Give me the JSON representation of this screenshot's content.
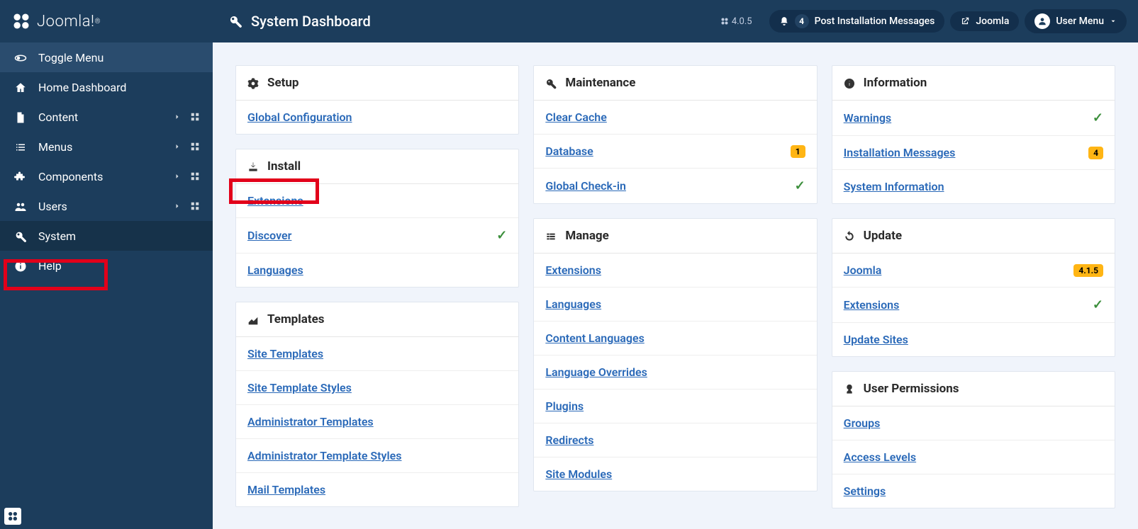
{
  "header": {
    "logo_text": "Joomla!",
    "title": "System Dashboard",
    "version": "4.0.5",
    "notifications": {
      "count": "4",
      "label": "Post Installation Messages"
    },
    "site_link": "Joomla",
    "user_menu": "User Menu"
  },
  "sidebar": {
    "toggle": "Toggle Menu",
    "items": [
      {
        "label": "Home Dashboard",
        "icon": "home"
      },
      {
        "label": "Content",
        "icon": "file",
        "expandable": true,
        "dash": true
      },
      {
        "label": "Menus",
        "icon": "list",
        "expandable": true,
        "dash": true
      },
      {
        "label": "Components",
        "icon": "puzzle",
        "expandable": true,
        "dash": true
      },
      {
        "label": "Users",
        "icon": "users",
        "expandable": true,
        "dash": true
      },
      {
        "label": "System",
        "icon": "wrench",
        "active": true,
        "highlight": true
      },
      {
        "label": "Help",
        "icon": "info"
      }
    ]
  },
  "panels": {
    "setup": {
      "title": "Setup",
      "links": [
        {
          "label": "Global Configuration"
        }
      ]
    },
    "install": {
      "title": "Install",
      "links": [
        {
          "label": "Extensions",
          "highlight": true
        },
        {
          "label": "Discover",
          "check": true
        },
        {
          "label": "Languages"
        }
      ]
    },
    "templates": {
      "title": "Templates",
      "links": [
        {
          "label": "Site Templates"
        },
        {
          "label": "Site Template Styles"
        },
        {
          "label": "Administrator Templates"
        },
        {
          "label": "Administrator Template Styles"
        },
        {
          "label": "Mail Templates"
        }
      ]
    },
    "maintenance": {
      "title": "Maintenance",
      "links": [
        {
          "label": "Clear Cache"
        },
        {
          "label": "Database",
          "badge": "1"
        },
        {
          "label": "Global Check-in",
          "check": true
        }
      ]
    },
    "manage": {
      "title": "Manage",
      "links": [
        {
          "label": "Extensions"
        },
        {
          "label": "Languages"
        },
        {
          "label": "Content Languages"
        },
        {
          "label": "Language Overrides"
        },
        {
          "label": "Plugins"
        },
        {
          "label": "Redirects"
        },
        {
          "label": "Site Modules"
        }
      ]
    },
    "information": {
      "title": "Information",
      "links": [
        {
          "label": "Warnings",
          "check": true
        },
        {
          "label": "Installation Messages",
          "badge": "4"
        },
        {
          "label": "System Information"
        }
      ]
    },
    "update": {
      "title": "Update",
      "links": [
        {
          "label": "Joomla",
          "badge": "4.1.5"
        },
        {
          "label": "Extensions",
          "check": true
        },
        {
          "label": "Update Sites"
        }
      ]
    },
    "permissions": {
      "title": "User Permissions",
      "links": [
        {
          "label": "Groups"
        },
        {
          "label": "Access Levels"
        },
        {
          "label": "Settings"
        }
      ]
    }
  }
}
